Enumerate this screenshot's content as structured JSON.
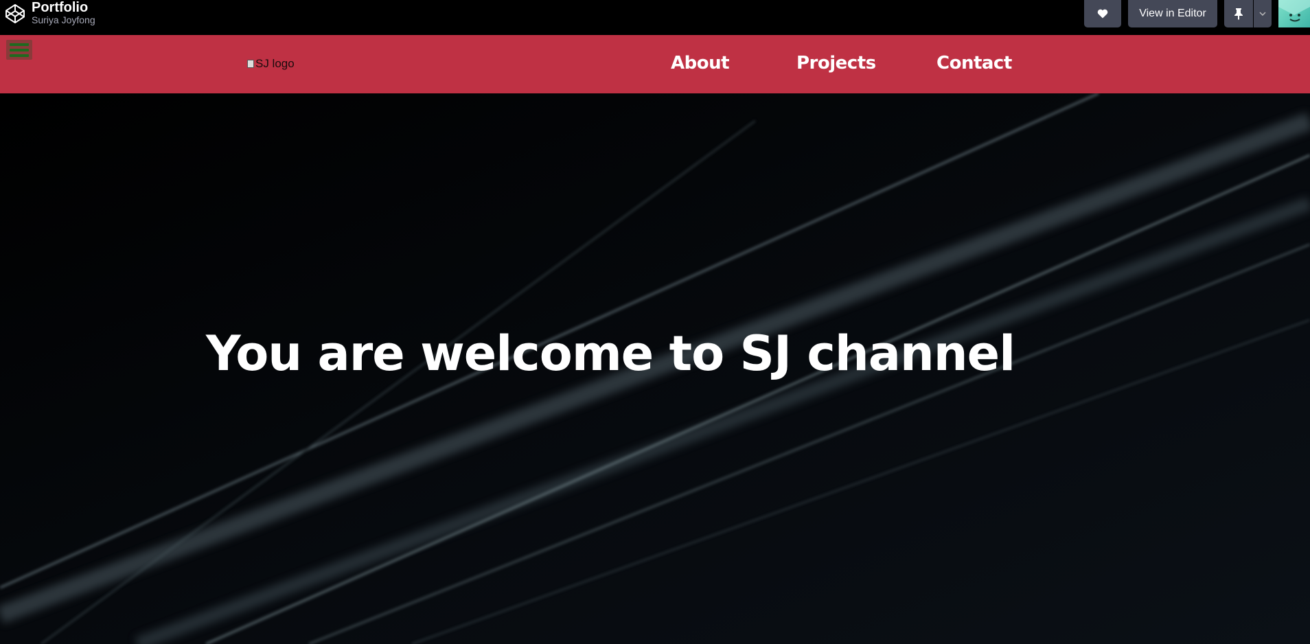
{
  "codepen": {
    "title": "Portfolio",
    "author": "Suriya Joyfong",
    "view_editor_label": "View in Editor",
    "icons": [
      "codepen-logo-icon",
      "heart-icon",
      "pin-icon",
      "chevron-down-icon",
      "avatar-icon"
    ]
  },
  "navbar": {
    "logo_alt": "SJ logo",
    "links": [
      "About",
      "Projects",
      "Contact"
    ],
    "menu_icon": "hamburger-icon",
    "colors": {
      "background": "#bf3144",
      "menu_button": "#8a3a3a",
      "menu_bars": "#1f6a1f"
    }
  },
  "hero": {
    "heading": "You are welcome to SJ channel"
  }
}
